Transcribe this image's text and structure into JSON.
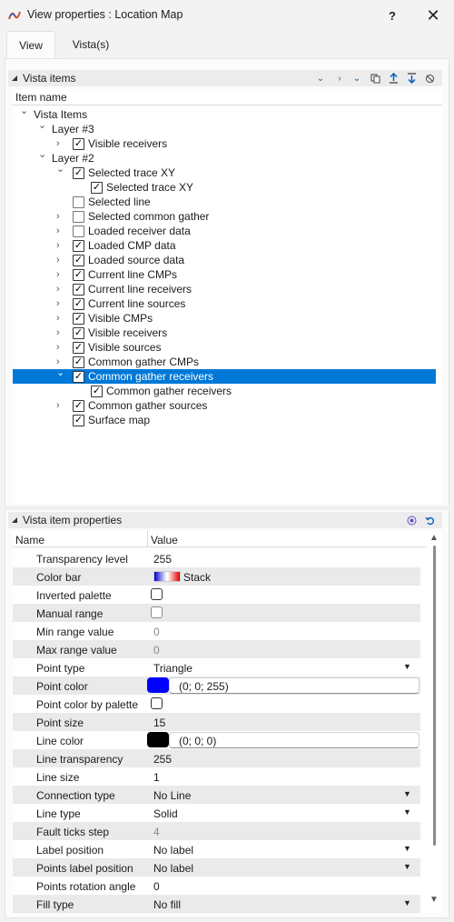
{
  "window": {
    "title": "View properties : Location Map",
    "help_label": "?",
    "close_label": "✕"
  },
  "tabs": [
    {
      "label": "View",
      "active": true
    },
    {
      "label": "Vista(s)",
      "active": false
    }
  ],
  "vista_items": {
    "header": "Vista items",
    "column_header": "Item name",
    "tree": [
      {
        "label": "Vista Items",
        "expanded": true,
        "checkbox": null,
        "depth": 0
      },
      {
        "label": "Layer  #3",
        "expanded": true,
        "checkbox": null,
        "depth": 1
      },
      {
        "label": "Visible receivers",
        "expanded": false,
        "checkbox": true,
        "depth": 2
      },
      {
        "label": "Layer  #2",
        "expanded": true,
        "checkbox": null,
        "depth": 1
      },
      {
        "label": "Selected trace XY",
        "expanded": true,
        "checkbox": true,
        "depth": 2
      },
      {
        "label": "Selected trace XY",
        "expanded": null,
        "checkbox": true,
        "depth": 3
      },
      {
        "label": "Selected line",
        "expanded": null,
        "checkbox": false,
        "depth": 2
      },
      {
        "label": "Selected common gather",
        "expanded": false,
        "checkbox": false,
        "depth": 2
      },
      {
        "label": "Loaded receiver data",
        "expanded": false,
        "checkbox": false,
        "depth": 2
      },
      {
        "label": "Loaded CMP data",
        "expanded": false,
        "checkbox": true,
        "depth": 2
      },
      {
        "label": "Loaded source data",
        "expanded": false,
        "checkbox": true,
        "depth": 2
      },
      {
        "label": "Current line CMPs",
        "expanded": false,
        "checkbox": true,
        "depth": 2
      },
      {
        "label": "Current line receivers",
        "expanded": false,
        "checkbox": true,
        "depth": 2
      },
      {
        "label": "Current line sources",
        "expanded": false,
        "checkbox": true,
        "depth": 2
      },
      {
        "label": "Visible CMPs",
        "expanded": false,
        "checkbox": true,
        "depth": 2
      },
      {
        "label": "Visible receivers",
        "expanded": false,
        "checkbox": true,
        "depth": 2
      },
      {
        "label": "Visible sources",
        "expanded": false,
        "checkbox": true,
        "depth": 2
      },
      {
        "label": "Common gather CMPs",
        "expanded": false,
        "checkbox": true,
        "depth": 2
      },
      {
        "label": "Common gather receivers",
        "expanded": true,
        "checkbox": true,
        "depth": 2,
        "selected": true
      },
      {
        "label": "Common gather receivers",
        "expanded": null,
        "checkbox": true,
        "depth": 3
      },
      {
        "label": "Common gather sources",
        "expanded": false,
        "checkbox": true,
        "depth": 2
      },
      {
        "label": "Surface map",
        "expanded": null,
        "checkbox": true,
        "depth": 2
      }
    ]
  },
  "vista_item_properties": {
    "header": "Vista item properties",
    "columns": {
      "name": "Name",
      "value": "Value"
    },
    "rows": [
      {
        "name": "Transparency level",
        "value": "255",
        "kind": "text"
      },
      {
        "name": "Color bar",
        "value": "Stack",
        "kind": "colorbar"
      },
      {
        "name": "Inverted palette",
        "value": "",
        "kind": "checkbox"
      },
      {
        "name": "Manual range",
        "value": "",
        "kind": "checkbox-disabled"
      },
      {
        "name": "Min range value",
        "value": "0",
        "kind": "disabled"
      },
      {
        "name": "Max range value",
        "value": "0",
        "kind": "disabled"
      },
      {
        "name": "Point type",
        "value": "Triangle",
        "kind": "dropdown"
      },
      {
        "name": "Point color",
        "value": "(0; 0; 255)",
        "kind": "color",
        "color": "#0000ff"
      },
      {
        "name": "Point color by palette",
        "value": "",
        "kind": "checkbox"
      },
      {
        "name": "Point size",
        "value": "15",
        "kind": "text"
      },
      {
        "name": "Line color",
        "value": "(0; 0; 0)",
        "kind": "color",
        "color": "#000000"
      },
      {
        "name": "Line transparency",
        "value": "255",
        "kind": "text"
      },
      {
        "name": "Line size",
        "value": "1",
        "kind": "text"
      },
      {
        "name": "Connection type",
        "value": "No Line",
        "kind": "dropdown"
      },
      {
        "name": "Line type",
        "value": "Solid",
        "kind": "dropdown"
      },
      {
        "name": "Fault ticks step",
        "value": "4",
        "kind": "disabled"
      },
      {
        "name": "Label position",
        "value": "No label",
        "kind": "dropdown"
      },
      {
        "name": "Points label position",
        "value": "No label",
        "kind": "dropdown"
      },
      {
        "name": "Points rotation angle",
        "value": "0",
        "kind": "text"
      },
      {
        "name": "Fill type",
        "value": "No fill",
        "kind": "dropdown"
      }
    ]
  },
  "colors": {
    "selection": "#0078d7",
    "alt_row": "#eaeaea"
  }
}
